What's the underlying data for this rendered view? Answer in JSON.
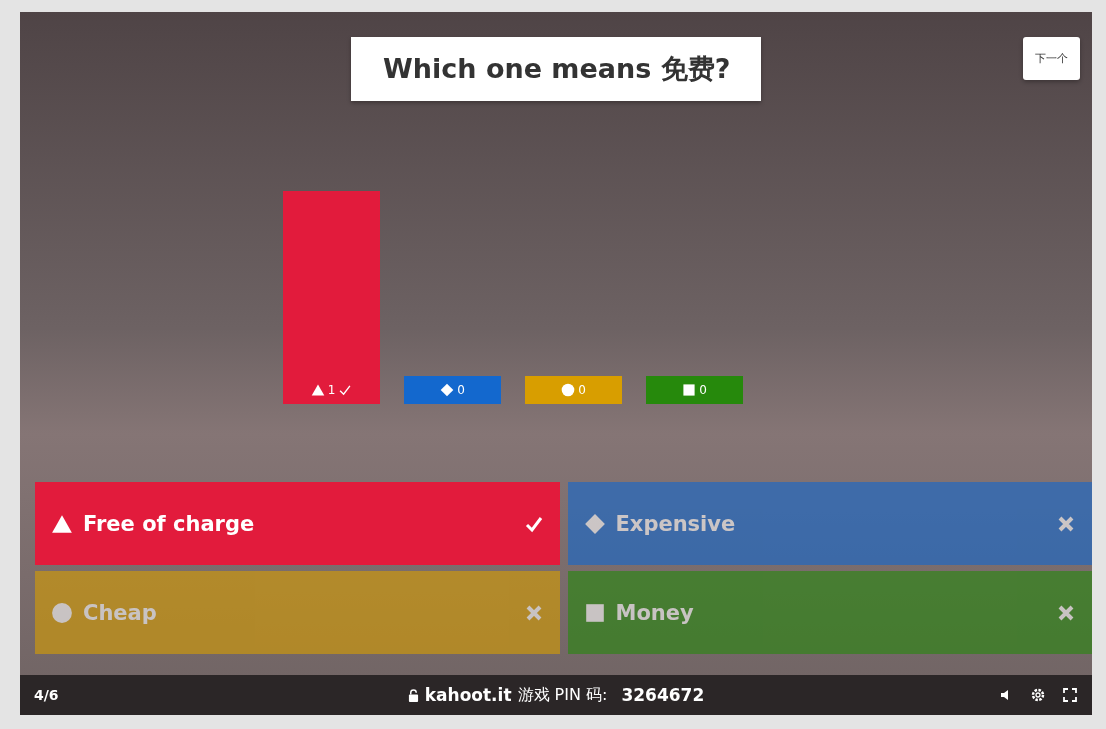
{
  "question": "Which one means 免费?",
  "next_button": "下一个",
  "answers": [
    {
      "text": "Free of charge",
      "kind": "triangle",
      "color": "#e21b3c",
      "correct": true,
      "count": "1"
    },
    {
      "text": "Expensive",
      "kind": "diamond",
      "color": "#1368ce",
      "correct": false,
      "count": "0"
    },
    {
      "text": "Cheap",
      "kind": "circle",
      "color": "#d89e00",
      "correct": false,
      "count": "0"
    },
    {
      "text": "Money",
      "kind": "square",
      "color": "#26890c",
      "correct": false,
      "count": "0"
    }
  ],
  "status_bar": {
    "progress": "4/6",
    "site": "kahoot.it",
    "pin_label": "游戏 PIN 码:",
    "pin": "3264672"
  }
}
